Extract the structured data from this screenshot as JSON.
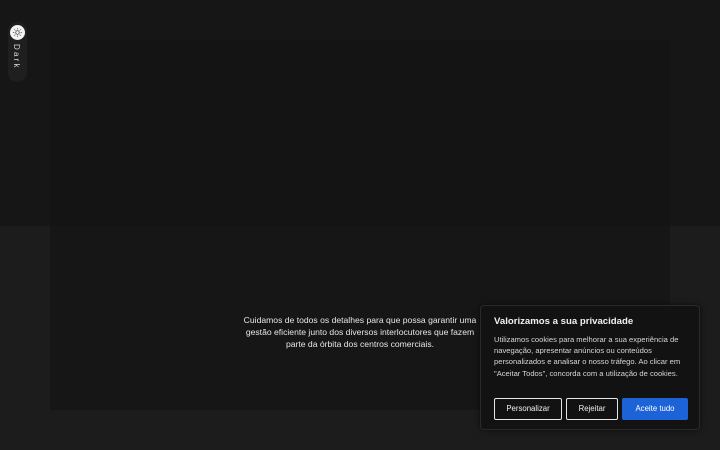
{
  "theme_toggle": {
    "label": "Dark",
    "icon": "sun-icon"
  },
  "hero": {
    "tagline": "Cuidamos de todos os detalhes para que possa garantir uma gestão eficiente junto dos diversos interlocutores que fazem parte da órbita dos centros comerciais."
  },
  "cookie_banner": {
    "title": "Valorizamos a sua privacidade",
    "description": "Utilizamos cookies para melhorar a sua experiência de navegação, apresentar anúncios ou conteúdos personalizados e analisar o nosso tráfego. Ao clicar em \"Aceitar Todos\", concorda com a utilização de cookies.",
    "buttons": {
      "customize": "Personalizar",
      "reject": "Rejeitar",
      "accept_all": "Aceite tudo"
    }
  },
  "colors": {
    "background": "#1c1c1c",
    "panel": "#161616",
    "accent": "#1d63d8"
  }
}
